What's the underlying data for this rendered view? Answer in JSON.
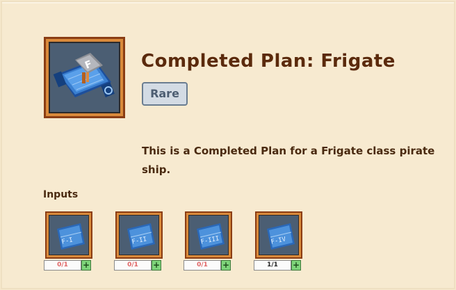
{
  "item": {
    "title": "Completed Plan: Frigate",
    "rarity": "Rare",
    "description": "This is a Completed Plan for a Frigate class pirate ship.",
    "icon": "frigate-plan-icon"
  },
  "inputs": {
    "label": "Inputs",
    "slots": [
      {
        "icon": "blueprint-icon",
        "icon_text": "F-I",
        "count": "0/1",
        "has_all": false
      },
      {
        "icon": "blueprint-icon",
        "icon_text": "F-II",
        "count": "0/1",
        "has_all": false
      },
      {
        "icon": "blueprint-icon",
        "icon_text": "F-III",
        "count": "0/1",
        "has_all": false
      },
      {
        "icon": "blueprint-icon",
        "icon_text": "F-IV",
        "count": "1/1",
        "has_all": true
      }
    ],
    "add_label": "+"
  },
  "colors": {
    "panel": "#f7ead0",
    "title": "#5b2a0c",
    "frame_outer": "#8a3d14",
    "frame_inner": "#d98a3b",
    "slot_bg": "#4b5e73",
    "missing": "#e06464",
    "add": "#7ed47a"
  }
}
